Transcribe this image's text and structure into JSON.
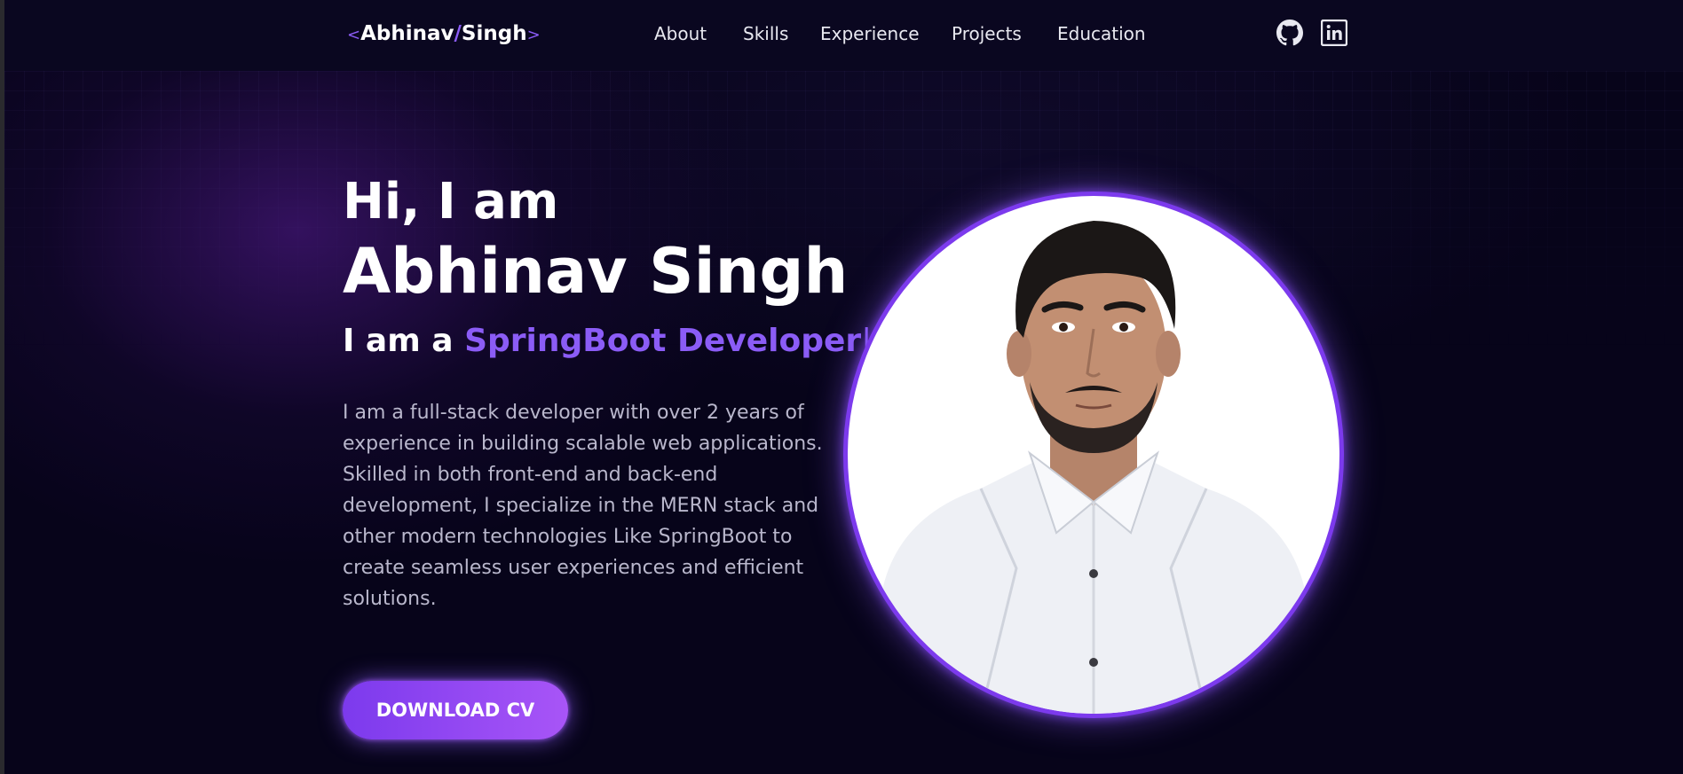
{
  "header": {
    "logo": {
      "open": "<",
      "first": "Abhinav",
      "slash": "/",
      "last": "Singh",
      "close": ">"
    },
    "nav": [
      {
        "label": "About"
      },
      {
        "label": "Skills"
      },
      {
        "label": "Experience"
      },
      {
        "label": "Projects"
      },
      {
        "label": "Education"
      }
    ],
    "social": [
      {
        "icon": "github-icon"
      },
      {
        "icon": "linkedin-icon"
      }
    ]
  },
  "hero": {
    "greeting": "Hi, I am",
    "name": "Abhinav Singh",
    "role_prefix": "I am a",
    "role_typed": "SpringBoot Developer",
    "role_cursor": "|",
    "bio": "I am a full-stack developer with over 2 years of experience in building scalable web applications. Skilled in both front-end and back-end development, I specialize in the MERN stack and other modern technologies Like SpringBoot to create seamless user experiences and efficient solutions.",
    "cta_label": "DOWNLOAD CV",
    "photo_icon": "profile-photo"
  },
  "colors": {
    "accent": "#8b5cf6",
    "background": "#050314",
    "text": "#ffffff",
    "muted_text": "#b9b7cc"
  }
}
